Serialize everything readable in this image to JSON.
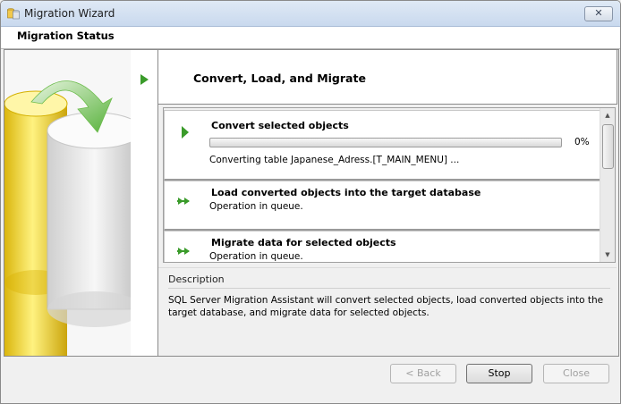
{
  "window": {
    "title": "Migration Wizard",
    "close_glyph": "✕"
  },
  "header": {
    "title": "Migration Status"
  },
  "current_step": {
    "title": "Convert, Load, and Migrate"
  },
  "steps": [
    {
      "title": "Convert selected objects",
      "status": "Converting table Japanese_Adress.[T_MAIN_MENU] ...",
      "icon": "play-icon",
      "progress": 0,
      "progress_label": "0%"
    },
    {
      "title": "Load converted objects into the target database",
      "status": "Operation in queue.",
      "icon": "double-arrow-icon"
    },
    {
      "title": "Migrate data for selected objects",
      "status": "Operation in queue.",
      "icon": "double-arrow-icon"
    }
  ],
  "description": {
    "label": "Description",
    "text": "SQL Server Migration Assistant will convert selected objects, load converted objects into the target database, and migrate data for selected objects."
  },
  "buttons": {
    "back": "< Back",
    "stop": "Stop",
    "close": "Close"
  },
  "colors": {
    "accent_green": "#3a9b2a",
    "progress_green": "#4fb23a"
  }
}
